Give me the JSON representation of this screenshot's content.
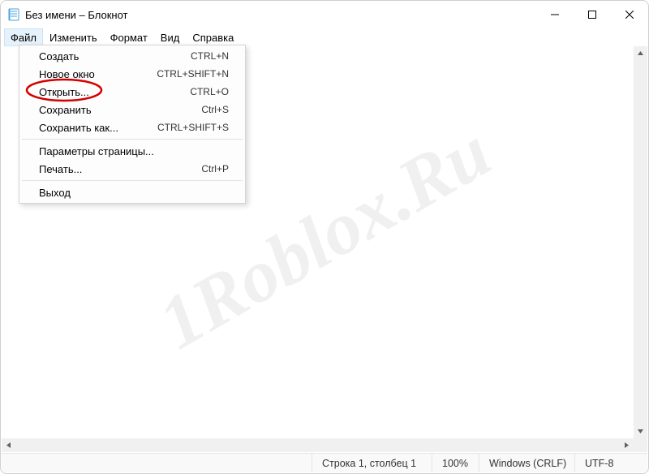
{
  "titlebar": {
    "title": "Без имени – Блокнот"
  },
  "menubar": {
    "items": [
      "Файл",
      "Изменить",
      "Формат",
      "Вид",
      "Справка"
    ]
  },
  "file_menu": {
    "items": [
      {
        "label": "Создать",
        "shortcut": "CTRL+N"
      },
      {
        "label": "Новое окно",
        "shortcut": "CTRL+SHIFT+N"
      },
      {
        "label": "Открыть...",
        "shortcut": "CTRL+O"
      },
      {
        "label": "Сохранить",
        "shortcut": "Ctrl+S"
      },
      {
        "label": "Сохранить как...",
        "shortcut": "CTRL+SHIFT+S"
      },
      {
        "sep": true
      },
      {
        "label": "Параметры страницы...",
        "shortcut": ""
      },
      {
        "label": "Печать...",
        "shortcut": "Ctrl+P"
      },
      {
        "sep": true
      },
      {
        "label": "Выход",
        "shortcut": ""
      }
    ]
  },
  "statusbar": {
    "position": "Строка 1, столбец 1",
    "zoom": "100%",
    "line_ending": "Windows (CRLF)",
    "encoding": "UTF-8"
  },
  "watermark": "1Roblox.Ru"
}
